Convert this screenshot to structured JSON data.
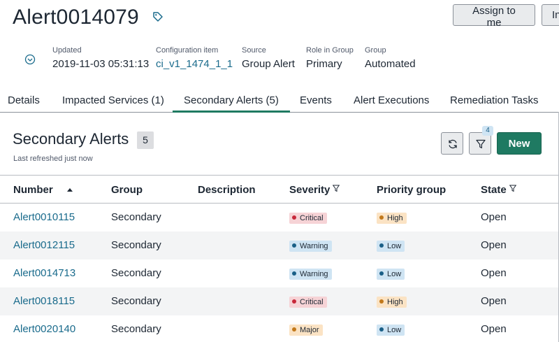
{
  "header": {
    "title": "Alert0014079",
    "assign_label": "Assign to me",
    "more_label": "In"
  },
  "meta": [
    {
      "label": "Updated",
      "value": "2019-11-03 05:31:13",
      "link": false
    },
    {
      "label": "Configuration item",
      "value": "ci_v1_1474_1_1",
      "link": true
    },
    {
      "label": "Source",
      "value": "Group Alert",
      "link": false
    },
    {
      "label": "Role in Group",
      "value": "Primary",
      "link": false
    },
    {
      "label": "Group",
      "value": "Automated",
      "link": false
    }
  ],
  "tabs": [
    {
      "label": "Details",
      "active": false
    },
    {
      "label": "Impacted Services (1)",
      "active": false
    },
    {
      "label": "Secondary Alerts (5)",
      "active": true
    },
    {
      "label": "Events",
      "active": false
    },
    {
      "label": "Alert Executions",
      "active": false
    },
    {
      "label": "Remediation Tasks",
      "active": false
    }
  ],
  "panel": {
    "title": "Secondary Alerts",
    "count": "5",
    "refreshed": "Last refreshed just now",
    "filter_count": "4",
    "new_label": "New"
  },
  "table": {
    "columns": [
      "Number",
      "Group",
      "Description",
      "Severity",
      "Priority group",
      "State"
    ],
    "rows": [
      {
        "number": "Alert0010115",
        "group": "Secondary",
        "description": "",
        "severity": "Critical",
        "priority": "High",
        "state": "Open"
      },
      {
        "number": "Alert0012115",
        "group": "Secondary",
        "description": "",
        "severity": "Warning",
        "priority": "Low",
        "state": "Open"
      },
      {
        "number": "Alert0014713",
        "group": "Secondary",
        "description": "",
        "severity": "Warning",
        "priority": "Low",
        "state": "Open"
      },
      {
        "number": "Alert0018115",
        "group": "Secondary",
        "description": "",
        "severity": "Critical",
        "priority": "High",
        "state": "Open"
      },
      {
        "number": "Alert0020140",
        "group": "Secondary",
        "description": "",
        "severity": "Major",
        "priority": "Low",
        "state": "Open"
      }
    ]
  },
  "colors": {
    "accent": "#1f7a62",
    "link": "#1a6b8c",
    "critical_bg": "#f6d3d6",
    "critical_dot": "#c8283a",
    "warning_bg": "#cfe4f3",
    "warning_dot": "#1a5f87",
    "major_bg": "#fbe3c4",
    "major_dot": "#c2791b",
    "high_bg": "#fbe3c4",
    "high_dot": "#c2791b",
    "low_bg": "#cfe4f3",
    "low_dot": "#1a5f87"
  },
  "icons": [
    "tag-icon",
    "chevron-down-circle-icon",
    "refresh-icon",
    "filter-icon",
    "sort-ascending-icon",
    "column-filter-icon"
  ]
}
